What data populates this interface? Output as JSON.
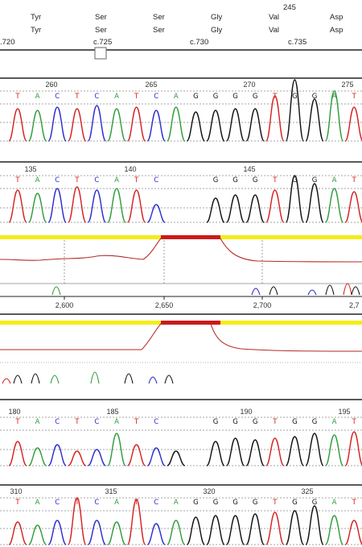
{
  "codon_header": {
    "protein_top": [
      "Tyr",
      "Ser",
      "Ser",
      "Gly",
      "Val",
      "Asp"
    ],
    "protein_bottom": [
      "Tyr",
      "Ser",
      "Ser",
      "Gly",
      "Val",
      "Asp"
    ],
    "codon_number": "245",
    "cdna_positions": [
      ".720",
      "c.725",
      "c.730",
      "c.735"
    ]
  },
  "traces": [
    {
      "numbers": [
        "260",
        "265",
        "270",
        "275"
      ],
      "bases": [
        "T",
        "A",
        "C",
        "T",
        "C",
        "A",
        "T",
        "C",
        "A",
        "G",
        "G",
        "G",
        "G",
        "T",
        "G",
        "G",
        "A",
        "T"
      ]
    },
    {
      "numbers": [
        "135",
        "140",
        "145"
      ],
      "bases": [
        "T",
        "A",
        "C",
        "T",
        "C",
        "A",
        "T",
        "C",
        "",
        "",
        "G",
        "G",
        "G",
        "T",
        "G",
        "G",
        "A",
        "T"
      ]
    },
    {
      "numbers": [
        "180",
        "185",
        "190",
        "195"
      ],
      "bases": [
        "T",
        "A",
        "C",
        "T",
        "C",
        "A",
        "T",
        "C",
        "",
        "",
        "G",
        "G",
        "G",
        "T",
        "G",
        "G",
        "A",
        "T"
      ]
    },
    {
      "numbers": [
        "310",
        "315",
        "320",
        "325"
      ],
      "bases": [
        "T",
        "A",
        "C",
        "T",
        "C",
        "A",
        "T",
        "C",
        "A",
        "G",
        "G",
        "G",
        "G",
        "T",
        "G",
        "G",
        "A",
        "T"
      ]
    }
  ],
  "axis_ticks": [
    "2,600",
    "2,650",
    "2,700",
    "2,7"
  ],
  "colors": {
    "A": "#2e9c3a",
    "C": "#2b2bd0",
    "G": "#111111",
    "T": "#d42020",
    "highlight": "#f5ec1a",
    "deletion": "#d01515",
    "trace": "#b52a2a"
  },
  "icons": [
    "scroll-thumb-icon"
  ]
}
